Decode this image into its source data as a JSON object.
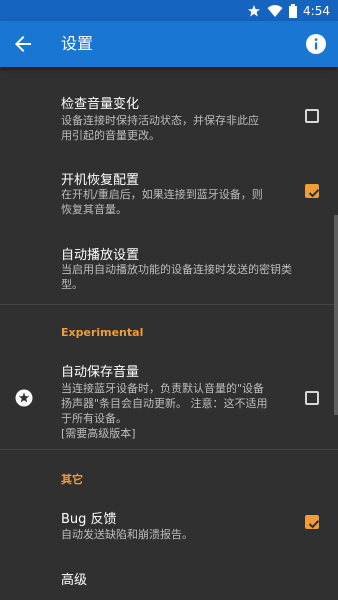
{
  "status_bar": {
    "time": "4:54"
  },
  "app_bar": {
    "title": "设置"
  },
  "prefs": {
    "check_volume": {
      "title": "检查音量变化",
      "summary": "设备连接时保持活动状态，并保存非此应\n用引起的音量更改。",
      "checked": false
    },
    "restore_on_boot": {
      "title": "开机恢复配置",
      "summary": "在开机/重启后，如果连接到蓝牙设备，则\n恢复其音量。",
      "checked": true
    },
    "autoplay": {
      "title": "自动播放设置",
      "summary": "当启用自动播放功能的设备连接时发送的密钥类\n型。"
    },
    "auto_save": {
      "title": "自动保存音量",
      "summary": "当连接蓝牙设备时，负责默认音量的\"设备\n扬声器\"条目会自动更新。 注意：这不适用\n于所有设备。\n[需要高级版本]",
      "checked": false
    },
    "bug_feedback": {
      "title": "Bug 反馈",
      "summary": "自动发送缺陷和崩溃报告。",
      "checked": true
    },
    "advanced": {
      "title": "高级"
    }
  },
  "categories": {
    "experimental": "Experimental",
    "other": "其它"
  },
  "icons": {
    "back": "arrow-back-icon",
    "info": "info-icon",
    "premium": "star-badge-icon"
  },
  "colors": {
    "accent": "#f29c38",
    "appbar": "#1976d2",
    "background": "#303030"
  }
}
